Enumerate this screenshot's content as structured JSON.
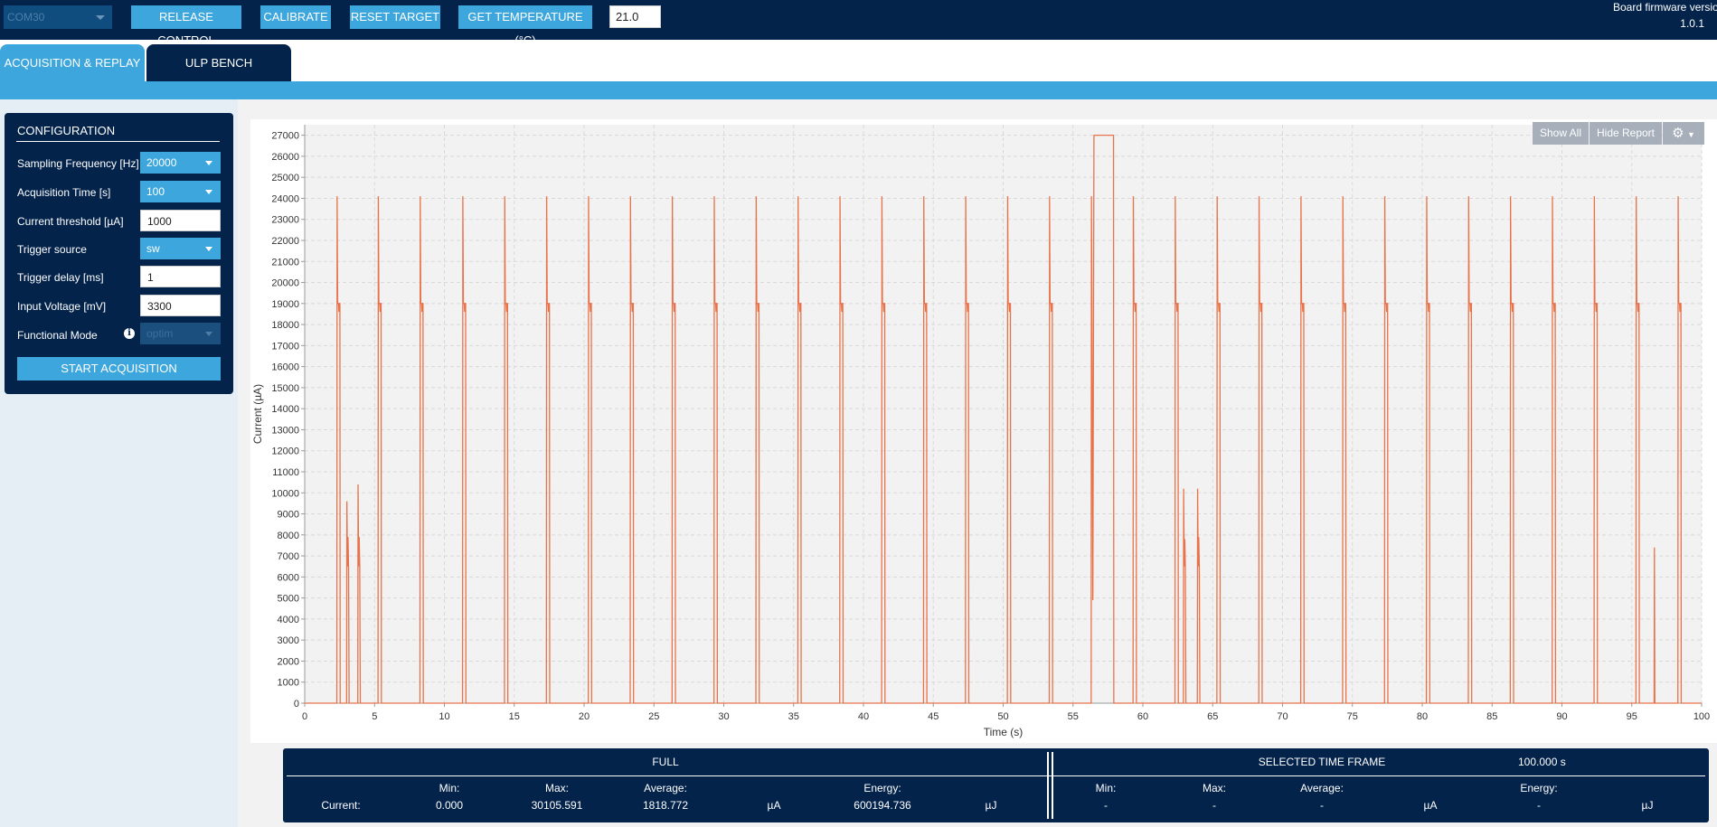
{
  "topbar": {
    "port": "COM30",
    "buttons": [
      "RELEASE CONTROL",
      "CALIBRATE",
      "RESET TARGET",
      "GET TEMPERATURE (°C)"
    ],
    "temperature_value": "21.0",
    "firmware_label": "Board firmware version",
    "firmware_version": "1.0.1"
  },
  "tabs": [
    "ACQUISITION & REPLAY",
    "ULP BENCH"
  ],
  "config": {
    "title": "CONFIGURATION",
    "rows": [
      {
        "label": "Sampling Frequency [Hz]",
        "value": "20000",
        "kind": "dropdown"
      },
      {
        "label": "Acquisition Time [s]",
        "value": "100",
        "kind": "dropdown"
      },
      {
        "label": "Current threshold [µA]",
        "value": "1000",
        "kind": "input"
      },
      {
        "label": "Trigger source",
        "value": "sw",
        "kind": "dropdown"
      },
      {
        "label": "Trigger delay [ms]",
        "value": "1",
        "kind": "input"
      },
      {
        "label": "Input Voltage [mV]",
        "value": "3300",
        "kind": "input"
      },
      {
        "label": "Functional Mode",
        "value": "optim",
        "kind": "dropdown-disabled"
      }
    ],
    "start_button": "START ACQUISITION"
  },
  "chart_buttons": {
    "show_all": "Show All",
    "hide_report": "Hide Report"
  },
  "chart_data": {
    "type": "line",
    "xlabel": "Time (s)",
    "ylabel": "Current (µA)",
    "xlim": [
      0,
      100
    ],
    "ylim": [
      0,
      27500
    ],
    "xticks": [
      0,
      5,
      10,
      15,
      20,
      25,
      30,
      35,
      40,
      45,
      50,
      55,
      60,
      65,
      70,
      75,
      80,
      85,
      90,
      95,
      100
    ],
    "yticks": [
      0,
      1000,
      2000,
      3000,
      4000,
      5000,
      6000,
      7000,
      8000,
      9000,
      10000,
      11000,
      12000,
      13000,
      14000,
      15000,
      16000,
      17000,
      18000,
      19000,
      20000,
      21000,
      22000,
      23000,
      24000,
      25000,
      26000,
      27000
    ],
    "grid": true,
    "series_color": "#e8734a",
    "pulses": {
      "t": [
        2.3,
        5.25,
        8.25,
        11.3,
        14.3,
        17.3,
        20.3,
        23.3,
        26.3,
        29.3,
        32.3,
        35.3,
        38.3,
        41.3,
        44.3,
        47.3,
        50.3,
        53.3,
        56.3,
        59.3,
        62.3,
        65.3,
        68.3,
        71.3,
        74.3,
        77.3,
        80.3,
        83.3,
        86.3,
        89.3,
        92.3,
        95.3,
        98.3
      ],
      "peak": 24100,
      "plateau": 19000,
      "width_s": 0.25
    },
    "sub_pulses": [
      {
        "t": 3.0,
        "peaks": [
          9600,
          7900,
          6500
        ]
      },
      {
        "t": 3.8,
        "peaks": [
          10400,
          7900,
          6500
        ]
      },
      {
        "t": 62.9,
        "peaks": [
          10200,
          7800,
          6500
        ]
      },
      {
        "t": 63.9,
        "peaks": [
          10200,
          7900,
          6500
        ]
      }
    ],
    "extra_spikes": [
      {
        "t": 96.6,
        "value": 7400
      }
    ],
    "saturation": {
      "t_start": 56.5,
      "t_end": 57.9,
      "value": 27000,
      "dip": 4900
    }
  },
  "report": {
    "full_title": "FULL",
    "selected_title": "SELECTED TIME FRAME",
    "selected_duration": "100.000 s",
    "headers": {
      "min": "Min:",
      "max": "Max:",
      "average": "Average:",
      "energy": "Energy:"
    },
    "row_label": "Current:",
    "full": {
      "min": "0.000",
      "max": "30105.591",
      "average": "1818.772",
      "avg_unit": "µA",
      "energy": "600194.736",
      "energy_unit": "µJ"
    },
    "selected": {
      "min": "-",
      "max": "-",
      "average": "-",
      "avg_unit": "µA",
      "energy": "-",
      "energy_unit": "µJ"
    }
  }
}
